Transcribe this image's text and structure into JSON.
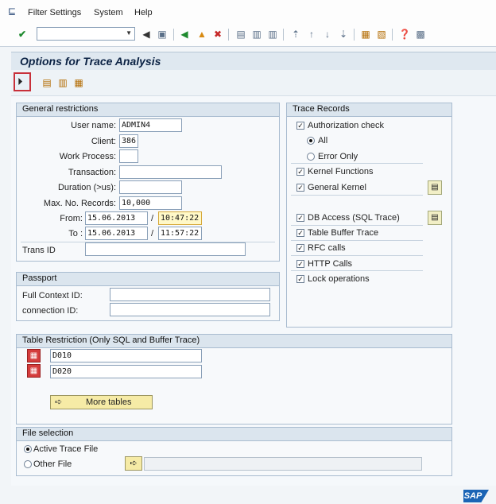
{
  "menubar": {
    "items": [
      "Filter Settings",
      "System",
      "Help"
    ]
  },
  "icons": {
    "system": "system-menu-icon",
    "enter": "enter-check-icon",
    "back": "back-icon",
    "exit": "exit-icon",
    "cancel": "cancel-icon",
    "execute": "execute-icon"
  },
  "colors": {
    "title": "#0b2244",
    "highlight": "#fff8c8",
    "accent_border": "#c8303a",
    "sap_blue": "#1b64b5"
  },
  "title": "Options for Trace Analysis",
  "general": {
    "header": "General restrictions",
    "user_label": "User name:",
    "user": "ADMIN4",
    "client_label": "Client:",
    "client": "386",
    "wp_label": "Work Process:",
    "wp": "",
    "trans_label": "Transaction:",
    "trans": "",
    "dur_label": "Duration (>us):",
    "dur": "",
    "max_label": "Max. No. Records:",
    "max": "10,000",
    "from_label": "From:",
    "from_date": "15.06.2013",
    "from_time": "10:47:22",
    "to_label": "To :",
    "to_date": "15.06.2013",
    "to_time": "11:57:22",
    "slash": "/",
    "transid_label": "Trans ID",
    "transid": ""
  },
  "passport": {
    "header": "Passport",
    "ctx_label": "Full Context ID:",
    "ctx": "",
    "conn_label": "connection ID:",
    "conn": ""
  },
  "trace": {
    "header": "Trace Records",
    "auth": "Authorization check",
    "all": "All",
    "error_only": "Error Only",
    "kernel_fn": "Kernel Functions",
    "gen_kernel": "General Kernel",
    "db": "DB Access (SQL Trace)",
    "buffer": "Table Buffer Trace",
    "rfc": "RFC calls",
    "http": "HTTP Calls",
    "lock": "Lock operations",
    "check_mark": "✓"
  },
  "tables": {
    "header": "Table Restriction (Only SQL and Buffer Trace)",
    "rows": [
      "D010",
      "D020"
    ],
    "more": "More tables"
  },
  "file": {
    "header": "File selection",
    "active": "Active Trace File",
    "other": "Other File",
    "path": ""
  },
  "logo": "SAP"
}
